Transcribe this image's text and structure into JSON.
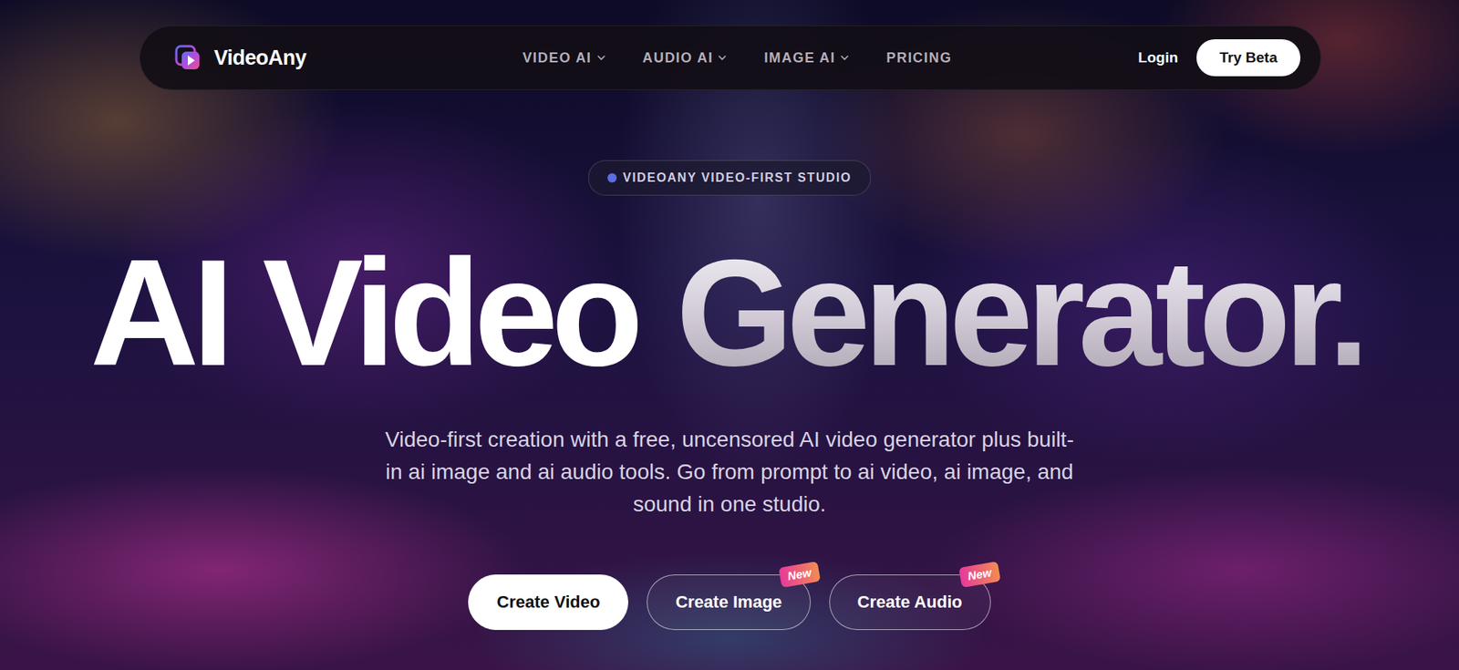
{
  "brand": {
    "name": "VideoAny"
  },
  "nav": {
    "items": [
      {
        "label": "VIDEO AI",
        "dropdown": true
      },
      {
        "label": "AUDIO AI",
        "dropdown": true
      },
      {
        "label": "IMAGE AI",
        "dropdown": true
      },
      {
        "label": "PRICING",
        "dropdown": false
      }
    ],
    "login": "Login",
    "cta": "Try Beta"
  },
  "hero": {
    "badge": "VIDEOANY VIDEO-FIRST STUDIO",
    "title": [
      {
        "text": "AI Video",
        "kind": "solid"
      },
      {
        "text": "Generator.",
        "kind": "gradient"
      }
    ],
    "subtitle": "Video-first creation with a free, uncensored AI video generator plus built-in ai image and ai audio tools. Go from prompt to ai video, ai image, and sound in one studio.",
    "buttons": [
      {
        "label": "Create Video",
        "kind": "primary"
      },
      {
        "label": "Create Image",
        "kind": "outline",
        "tag": "New"
      },
      {
        "label": "Create Audio",
        "kind": "outline",
        "tag": "New"
      }
    ]
  }
}
